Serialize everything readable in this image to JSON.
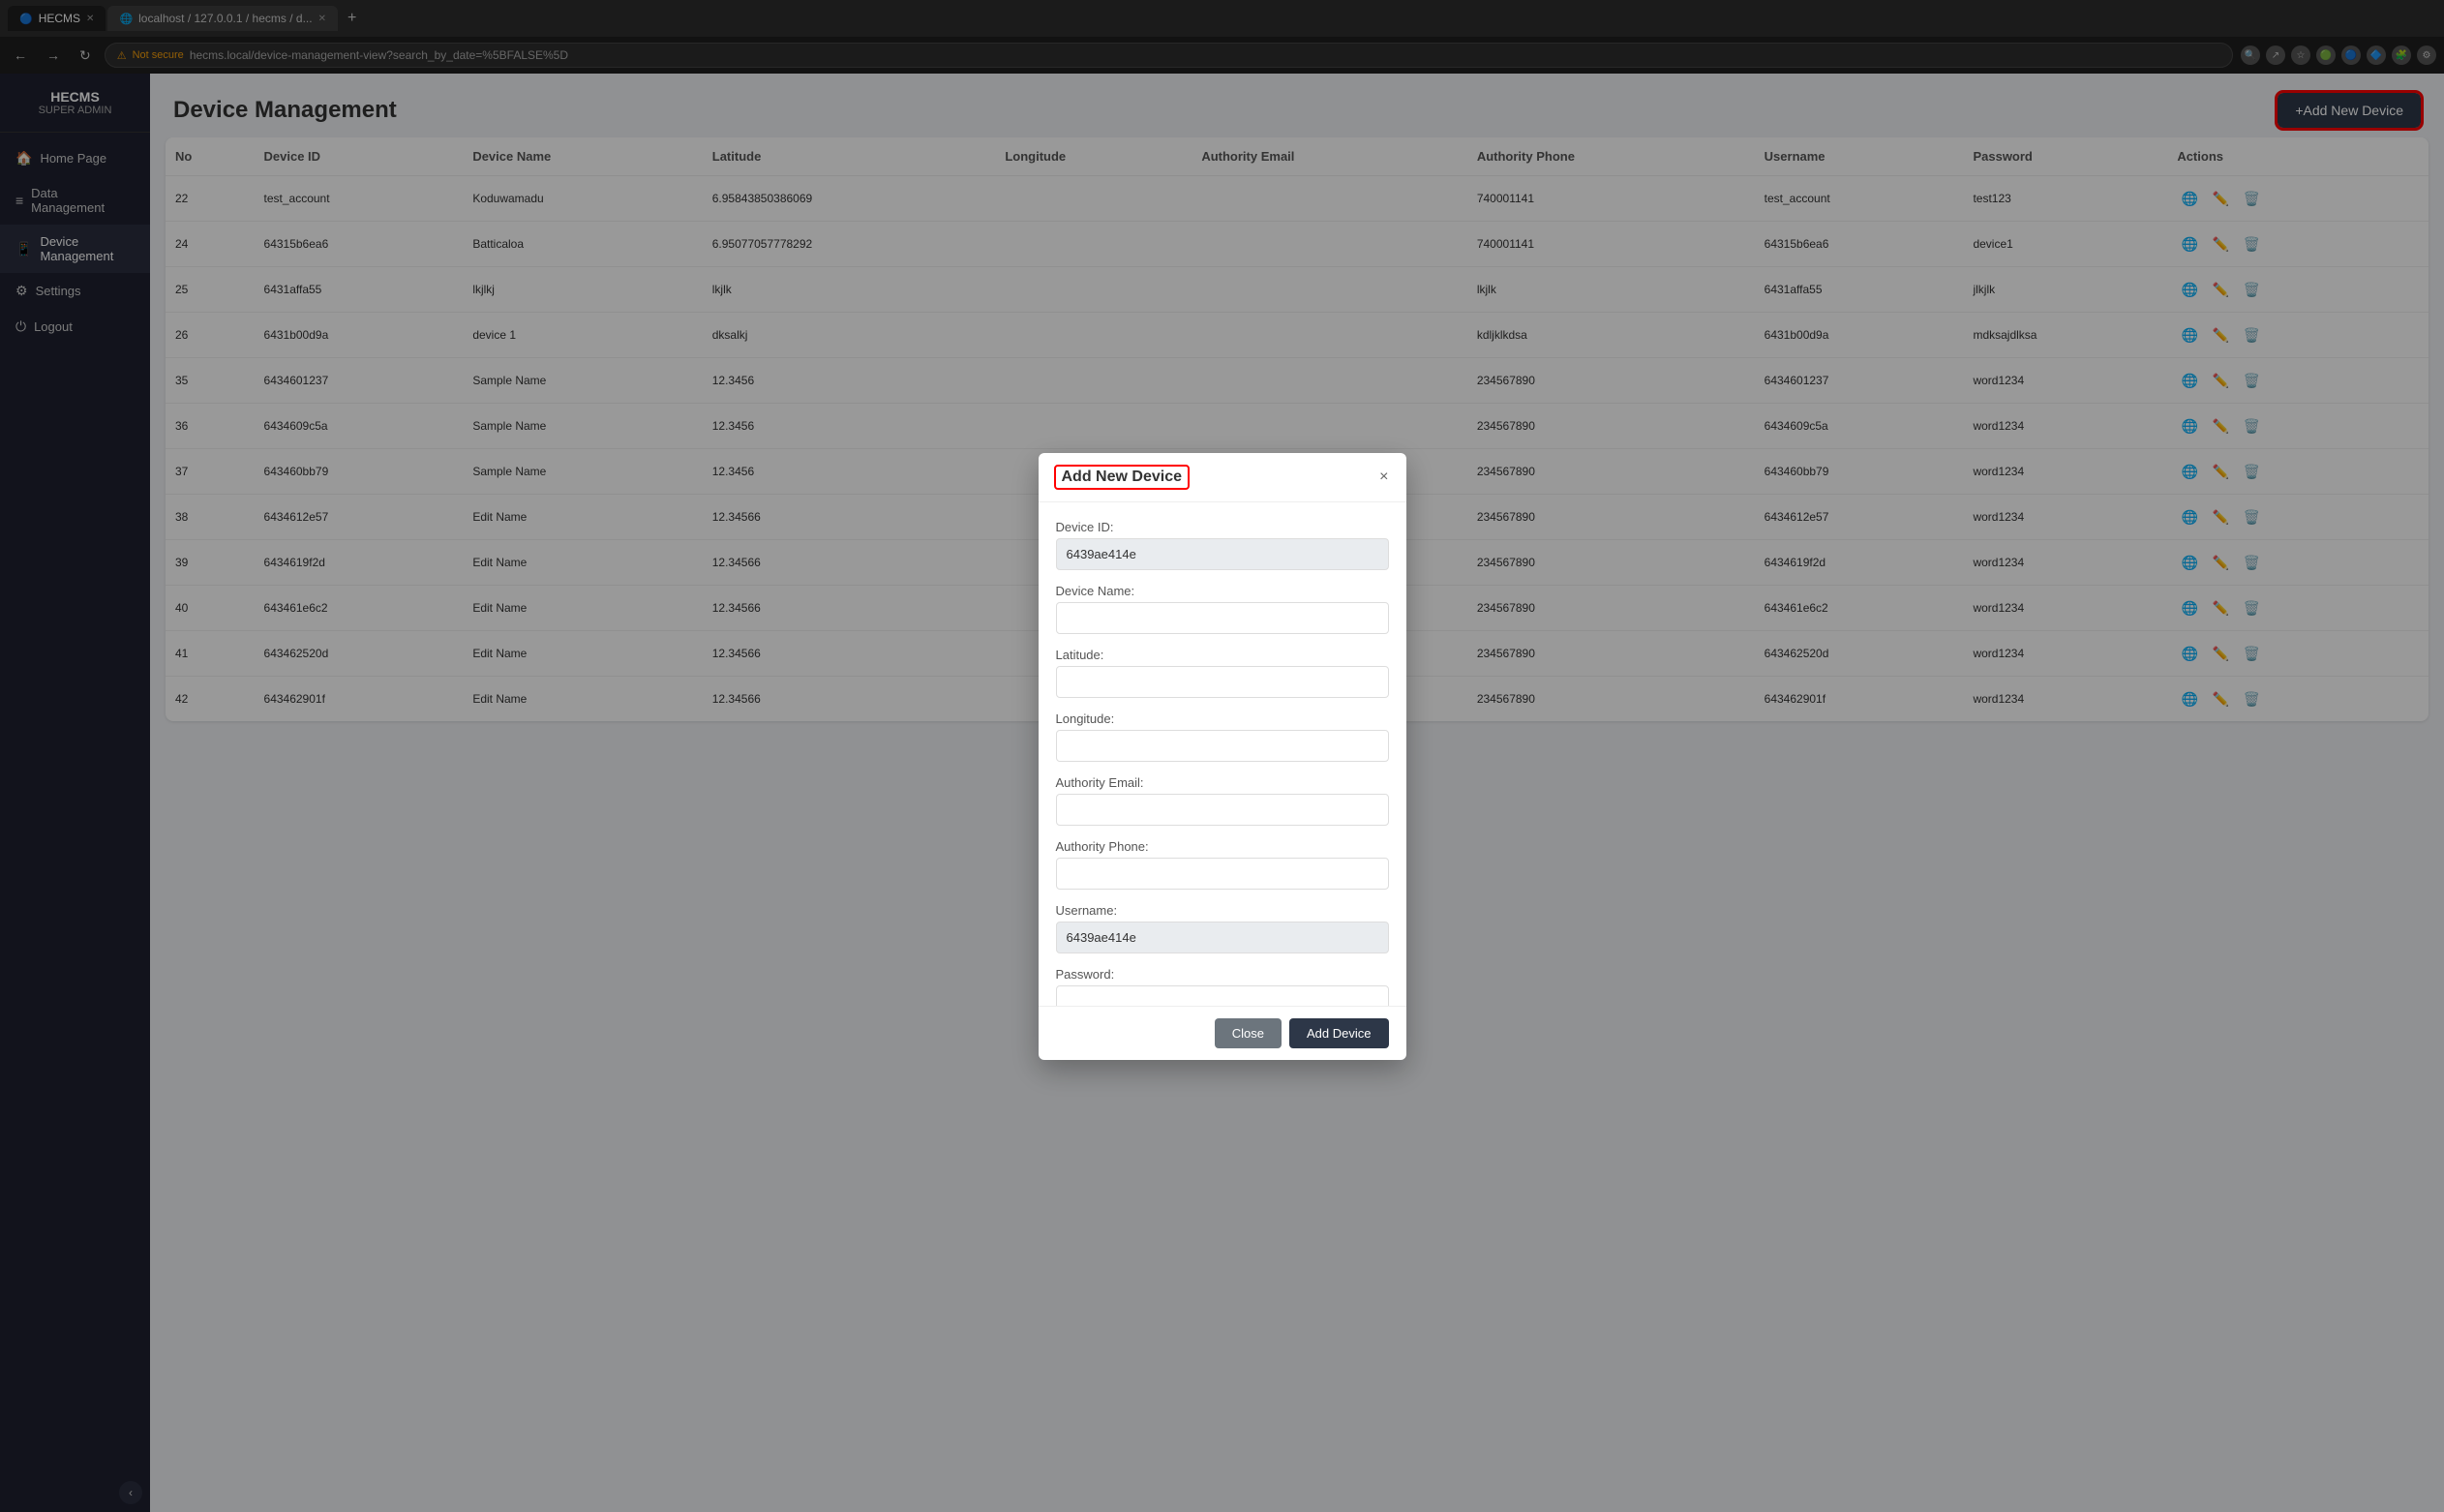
{
  "browser": {
    "tabs": [
      {
        "label": "HECMS",
        "active": true,
        "favicon": "H"
      },
      {
        "label": "localhost / 127.0.0.1 / hecms / d...",
        "active": false,
        "favicon": "L"
      }
    ],
    "address": "hecms.local/device-management-view?search_by_date=%5BFALSE%5D",
    "insecure_label": "Not secure"
  },
  "sidebar": {
    "app_name": "HECMS",
    "app_subtitle": "SUPER ADMIN",
    "items": [
      {
        "label": "Home Page",
        "icon": "🏠",
        "active": false
      },
      {
        "label": "Data Management",
        "icon": "📊",
        "active": false
      },
      {
        "label": "Device Management",
        "icon": "📱",
        "active": true
      },
      {
        "label": "Settings",
        "icon": "⚙",
        "active": false
      },
      {
        "label": "Logout",
        "icon": "⏻",
        "active": false
      }
    ],
    "collapse_icon": "‹"
  },
  "page": {
    "title": "Device Management",
    "add_button_label": "+Add New Device"
  },
  "table": {
    "columns": [
      "No",
      "Device ID",
      "Device Name",
      "Latitude",
      "Longitude",
      "Authority Email",
      "Authority Phone",
      "Username",
      "Password",
      "Actions"
    ],
    "rows": [
      {
        "no": 22,
        "device_id": "test_account",
        "device_name": "Koduwamadu",
        "latitude": "6.95843850386069",
        "longitude": "",
        "auth_email": "",
        "auth_phone": "740001141",
        "username": "test_account",
        "password": "test123"
      },
      {
        "no": 24,
        "device_id": "64315b6ea6",
        "device_name": "Batticaloa",
        "latitude": "6.95077057778292",
        "longitude": "",
        "auth_email": "",
        "auth_phone": "740001141",
        "username": "64315b6ea6",
        "password": "device1"
      },
      {
        "no": 25,
        "device_id": "6431affa55",
        "device_name": "lkjlkj",
        "latitude": "lkjlk",
        "longitude": "",
        "auth_email": "",
        "auth_phone": "lkjlk",
        "username": "6431affa55",
        "password": "jlkjlk"
      },
      {
        "no": 26,
        "device_id": "6431b00d9a",
        "device_name": "device 1",
        "latitude": "dksalkj",
        "longitude": "",
        "auth_email": "",
        "auth_phone": "kdljklkdsa",
        "username": "6431b00d9a",
        "password": "mdksajdlksa"
      },
      {
        "no": 35,
        "device_id": "6434601237",
        "device_name": "Sample Name",
        "latitude": "12.3456",
        "longitude": "",
        "auth_email": "",
        "auth_phone": "234567890",
        "username": "6434601237",
        "password": "word1234"
      },
      {
        "no": 36,
        "device_id": "6434609c5a",
        "device_name": "Sample Name",
        "latitude": "12.3456",
        "longitude": "",
        "auth_email": "",
        "auth_phone": "234567890",
        "username": "6434609c5a",
        "password": "word1234"
      },
      {
        "no": 37,
        "device_id": "643460bb79",
        "device_name": "Sample Name",
        "latitude": "12.3456",
        "longitude": "",
        "auth_email": "",
        "auth_phone": "234567890",
        "username": "643460bb79",
        "password": "word1234"
      },
      {
        "no": 38,
        "device_id": "6434612e57",
        "device_name": "Edit Name",
        "latitude": "12.34566",
        "longitude": "",
        "auth_email": "",
        "auth_phone": "234567890",
        "username": "6434612e57",
        "password": "word1234"
      },
      {
        "no": 39,
        "device_id": "6434619f2d",
        "device_name": "Edit Name",
        "latitude": "12.34566",
        "longitude": "",
        "auth_email": "",
        "auth_phone": "234567890",
        "username": "6434619f2d",
        "password": "word1234"
      },
      {
        "no": 40,
        "device_id": "643461e6c2",
        "device_name": "Edit Name",
        "latitude": "12.34566",
        "longitude": "",
        "auth_email": "",
        "auth_phone": "234567890",
        "username": "643461e6c2",
        "password": "word1234"
      },
      {
        "no": 41,
        "device_id": "643462520d",
        "device_name": "Edit Name",
        "latitude": "12.34566",
        "longitude": "",
        "auth_email": "",
        "auth_phone": "234567890",
        "username": "643462520d",
        "password": "word1234"
      },
      {
        "no": 42,
        "device_id": "643462901f",
        "device_name": "Edit Name",
        "latitude": "12.34566",
        "longitude": "",
        "auth_email": "",
        "auth_phone": "234567890",
        "username": "643462901f",
        "password": "word1234"
      }
    ]
  },
  "modal": {
    "title": "Add New Device",
    "close_btn": "×",
    "fields": {
      "device_id_label": "Device ID:",
      "device_id_value": "6439ae414e",
      "device_name_label": "Device Name:",
      "device_name_placeholder": "",
      "latitude_label": "Latitude:",
      "latitude_placeholder": "",
      "longitude_label": "Longitude:",
      "longitude_placeholder": "",
      "authority_email_label": "Authority Email:",
      "authority_email_placeholder": "",
      "authority_phone_label": "Authority Phone:",
      "authority_phone_placeholder": "",
      "username_label": "Username:",
      "username_value": "6439ae414e",
      "password_label": "Password:",
      "password_placeholder": ""
    },
    "close_button_label": "Close",
    "add_button_label": "Add Device"
  }
}
